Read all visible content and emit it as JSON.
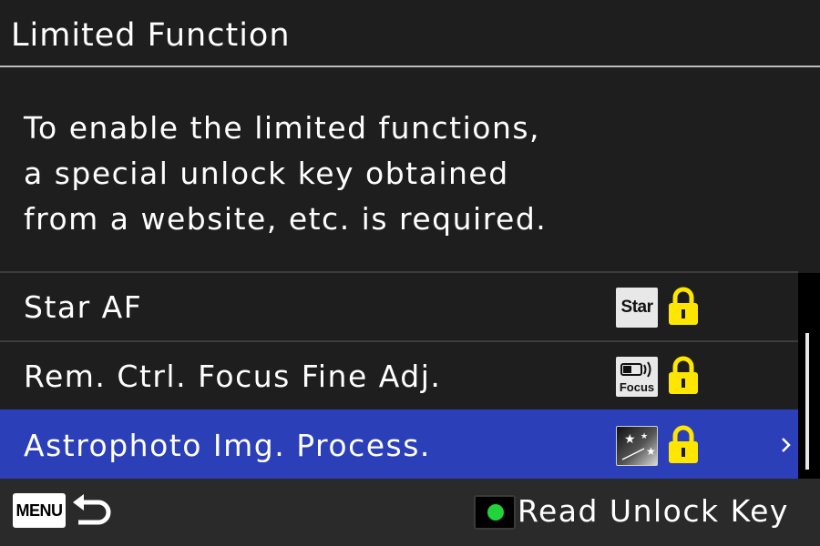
{
  "header": {
    "title": "Limited Function"
  },
  "message": {
    "lines": [
      "To enable the limited functions,",
      "a special unlock key obtained",
      "from a website, etc. is required."
    ]
  },
  "list": {
    "items": [
      {
        "label": "Star AF",
        "badge_text": "Star",
        "locked": true,
        "selected": false
      },
      {
        "label": "Rem. Ctrl. Focus Fine Adj.",
        "badge_text": "Focus",
        "locked": true,
        "selected": false
      },
      {
        "label": "Astrophoto Img. Process.",
        "locked": true,
        "selected": true
      }
    ]
  },
  "footer": {
    "menu_key_label": "MENU",
    "action_label": "Read Unlock Key"
  },
  "colors": {
    "background": "#1e1e1e",
    "selection": "#2b3fb8",
    "lock": "#ffe600",
    "green_button": "#22d33a"
  },
  "icons": [
    "star-af-icon",
    "remote-focus-icon",
    "astrophoto-icon",
    "lock-icon",
    "chevron-right-icon",
    "back-arrow-icon",
    "green-button-icon"
  ]
}
